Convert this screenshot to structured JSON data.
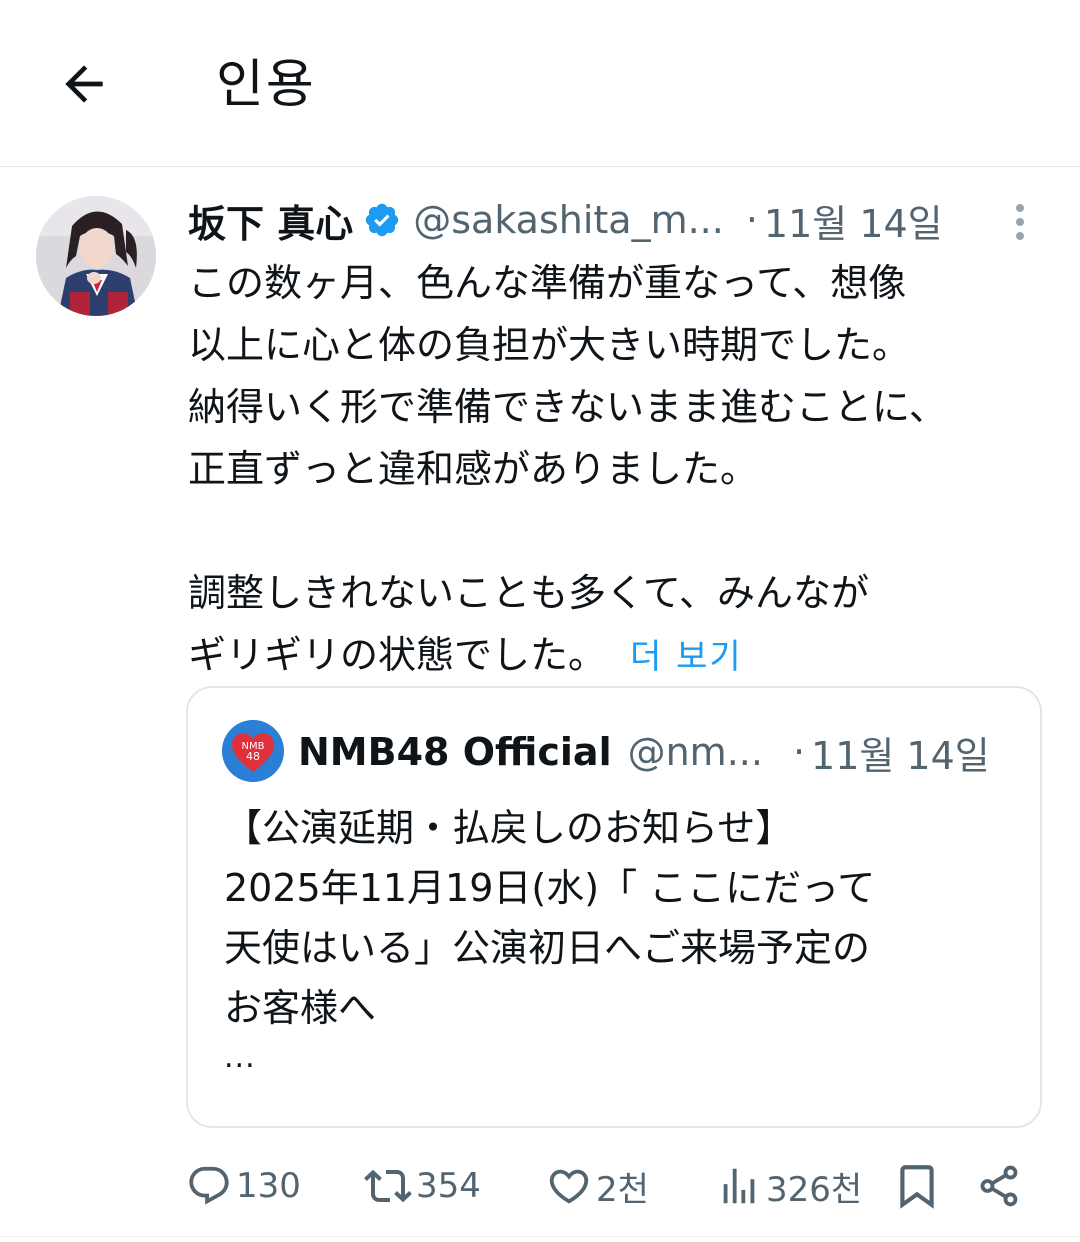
{
  "header": {
    "title": "인용",
    "back_icon": "arrow-left-icon"
  },
  "tweet": {
    "author_name": "坂下 真心",
    "verified": true,
    "handle": "@sakashita_m...",
    "separator": "·",
    "date": "11월 14일",
    "body_lines": [
      "この数ヶ月、色んな準備が重なって、想像",
      "以上に心と体の負担が大きい時期でした。",
      "納得いく形で準備できないまま進むことに、",
      "正直ずっと違和感がありました。",
      "",
      "調整しきれないことも多くて、みんなが",
      "ギリギリの状態でした。"
    ],
    "show_more": "더 보기"
  },
  "quote": {
    "author_name": "NMB48 Official",
    "avatar_text": "NMB 48",
    "handle": "@nm...",
    "separator": "·",
    "date": "11월 14일",
    "body_lines": [
      "【公演延期・払戻しのお知らせ】",
      "2025年11月19日(水)「 ここにだって",
      "天使はいる」公演初日へご来場予定の",
      "お客様へ"
    ],
    "ellipsis": "..."
  },
  "actions": {
    "reply_count": "130",
    "retweet_count": "354",
    "like_count": "2천",
    "views_count": "326천"
  },
  "colors": {
    "accent": "#1d9bf0",
    "text_primary": "#0f1419",
    "text_secondary": "#536471",
    "border": "#e3e6e8",
    "nmb_avatar_bg": "#2b7fd6",
    "nmb_heart": "#e0303a"
  }
}
